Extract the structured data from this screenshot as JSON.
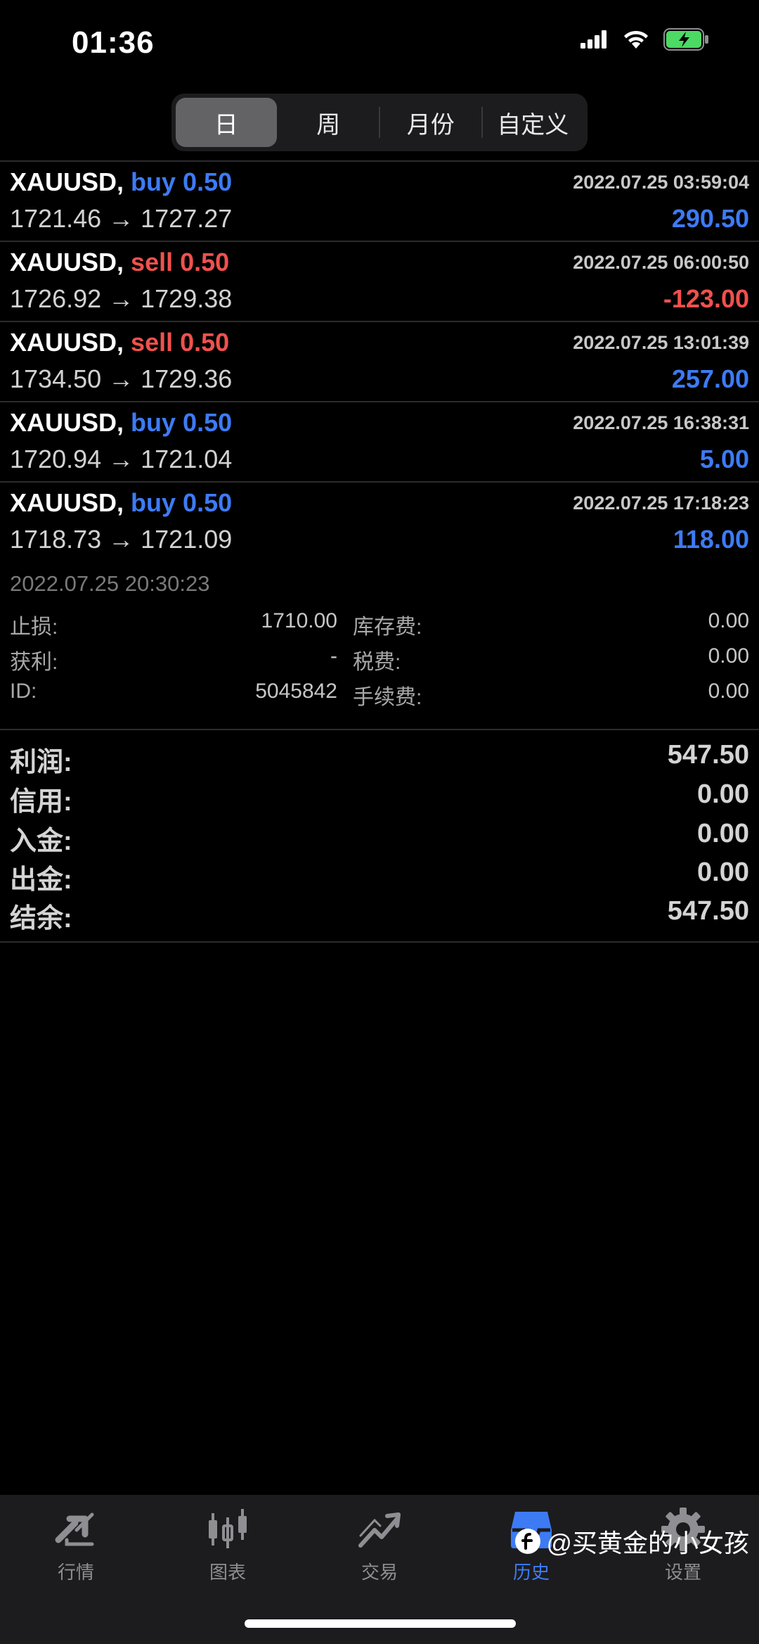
{
  "status": {
    "time": "01:36"
  },
  "segments": [
    {
      "label": "日",
      "active": true
    },
    {
      "label": "周",
      "active": false
    },
    {
      "label": "月份",
      "active": false
    },
    {
      "label": "自定义",
      "active": false
    }
  ],
  "deals": [
    {
      "symbol": "XAUUSD,",
      "direction": "buy 0.50",
      "type": "buy",
      "time": "2022.07.25 03:59:04",
      "price": "1721.46 → 1727.27",
      "profit": "290.50",
      "sign": "pos"
    },
    {
      "symbol": "XAUUSD,",
      "direction": "sell 0.50",
      "type": "sell",
      "time": "2022.07.25 06:00:50",
      "price": "1726.92 → 1729.38",
      "profit": "-123.00",
      "sign": "neg"
    },
    {
      "symbol": "XAUUSD,",
      "direction": "sell 0.50",
      "type": "sell",
      "time": "2022.07.25 13:01:39",
      "price": "1734.50 → 1729.36",
      "profit": "257.00",
      "sign": "pos"
    },
    {
      "symbol": "XAUUSD,",
      "direction": "buy 0.50",
      "type": "buy",
      "time": "2022.07.25 16:38:31",
      "price": "1720.94 → 1721.04",
      "profit": "5.00",
      "sign": "pos"
    },
    {
      "symbol": "XAUUSD,",
      "direction": "buy 0.50",
      "type": "buy",
      "time": "2022.07.25 17:18:23",
      "price": "1718.73 → 1721.09",
      "profit": "118.00",
      "sign": "pos"
    }
  ],
  "detail": {
    "date": "2022.07.25 20:30:23",
    "rows": [
      {
        "k1": "止损:",
        "v1": "1710.00",
        "k2": "库存费:",
        "v2": "0.00"
      },
      {
        "k1": "获利:",
        "v1": "-",
        "k2": "税费:",
        "v2": "0.00"
      },
      {
        "k1": "ID:",
        "v1": "5045842",
        "k2": "手续费:",
        "v2": "0.00"
      }
    ]
  },
  "summary": [
    {
      "label": "利润:",
      "value": "547.50"
    },
    {
      "label": "信用:",
      "value": "0.00"
    },
    {
      "label": "入金:",
      "value": "0.00"
    },
    {
      "label": "出金:",
      "value": "0.00"
    },
    {
      "label": "结余:",
      "value": "547.50"
    }
  ],
  "tabs": [
    {
      "label": "行情",
      "icon": "quotes-icon",
      "active": false
    },
    {
      "label": "图表",
      "icon": "chart-icon",
      "active": false
    },
    {
      "label": "交易",
      "icon": "trade-icon",
      "active": false
    },
    {
      "label": "历史",
      "icon": "history-icon",
      "active": true
    },
    {
      "label": "设置",
      "icon": "settings-icon",
      "active": false
    }
  ],
  "watermark": "@买黄金的小女孩",
  "colors": {
    "buy": "#3d7bf5",
    "sell": "#f0514e",
    "accent": "#3d7bf5"
  }
}
